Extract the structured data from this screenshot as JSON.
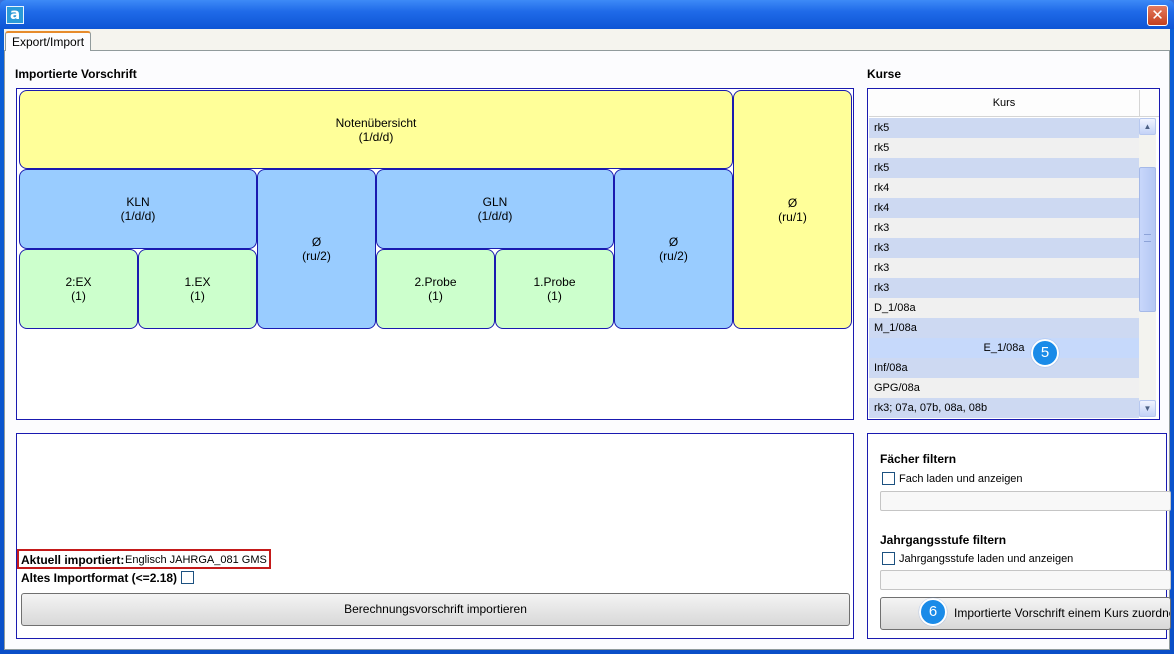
{
  "window": {
    "app_icon_glyph": "a",
    "close_glyph": "✕"
  },
  "tab": {
    "label": "Export/Import"
  },
  "left": {
    "section_title": "Importierte Vorschrift",
    "tree": {
      "root": {
        "title": "Notenübersicht",
        "sub": "(1/d/d)"
      },
      "root_avg": {
        "title": "Ø",
        "sub": "(ru/1)"
      },
      "kln": {
        "title": "KLN",
        "sub": "(1/d/d)"
      },
      "kln_avg": {
        "title": "Ø",
        "sub": "(ru/2)"
      },
      "gln": {
        "title": "GLN",
        "sub": "(1/d/d)"
      },
      "gln_avg": {
        "title": "Ø",
        "sub": "(ru/2)"
      },
      "ex2": {
        "title": "2:EX",
        "sub": "(1)"
      },
      "ex1": {
        "title": "1.EX",
        "sub": "(1)"
      },
      "probe2": {
        "title": "2.Probe",
        "sub": "(1)"
      },
      "probe1": {
        "title": "1.Probe",
        "sub": "(1)"
      }
    },
    "imported_label": "Aktuell importiert:",
    "imported_value": "Englisch JAHRGA_081 GMS",
    "old_format_label": "Altes Importformat (<=2.18)",
    "import_button": "Berechnungsvorschrift importieren"
  },
  "right": {
    "section_title": "Kurse",
    "column_header": "Kurs",
    "rows": [
      "rk5",
      "rk5",
      "rk5",
      "rk4",
      "rk4",
      "rk3",
      "rk3",
      "rk3",
      "rk3",
      "D_1/08a",
      "M_1/08a",
      "E_1/08a",
      "Inf/08a",
      "GPG/08a",
      "rk3; 07a, 07b, 08a, 08b"
    ],
    "selected_index": 11,
    "badge_5": "5",
    "subject_filter_title": "Fächer filtern",
    "subject_filter_check": "Fach laden und anzeigen",
    "grade_filter_title": "Jahrgangsstufe filtern",
    "grade_filter_check": "Jahrgangsstufe laden und anzeigen",
    "assign_button": "Importierte Vorschrift einem Kurs zuordnen",
    "badge_6": "6"
  },
  "icons": {
    "scroll_up": "▲",
    "scroll_down": "▼"
  }
}
